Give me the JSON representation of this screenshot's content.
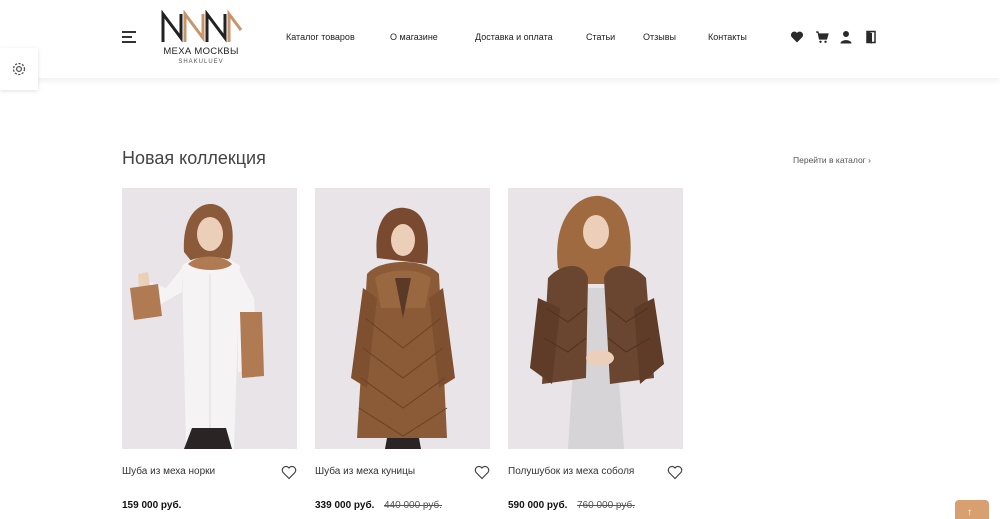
{
  "brand": {
    "name": "МЕХА МОСКВЫ",
    "sub": "SHAKULUEV",
    "accent": "#c8956a"
  },
  "nav": {
    "items": [
      {
        "label": "Каталог товаров"
      },
      {
        "label": "О магазине"
      },
      {
        "label": "Доставка и оплата"
      },
      {
        "label": "Статьи"
      },
      {
        "label": "Отзывы"
      },
      {
        "label": "Контакты"
      }
    ]
  },
  "header_icons": [
    "heart-icon",
    "cart-icon",
    "user-icon",
    "door-icon"
  ],
  "section": {
    "title": "Новая коллекция",
    "catalog_link": "Перейти в каталог ›"
  },
  "products": [
    {
      "name": "Шуба из меха норки",
      "price": "159 000 руб.",
      "old_price": ""
    },
    {
      "name": "Шуба из меха куницы",
      "price": "339 000 руб.",
      "old_price": "440 000 руб."
    },
    {
      "name": "Полушубок из меха соболя",
      "price": "590 000 руб.",
      "old_price": "760 000 руб."
    }
  ],
  "colors": {
    "scroll_top_button": "#d8a070",
    "photo_background": "#e8e4e8"
  }
}
